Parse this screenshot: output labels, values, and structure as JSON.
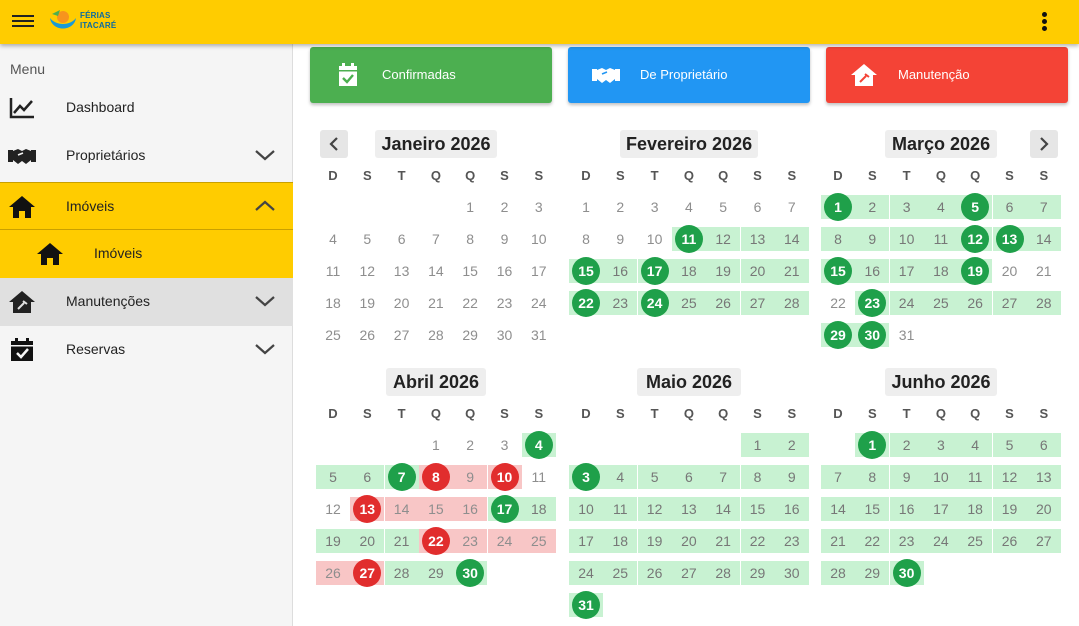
{
  "header": {
    "logo_text_line1": "FÉRIAS",
    "logo_text_line2": "ITACARÉ"
  },
  "sidebar": {
    "menu_label": "Menu",
    "items": [
      {
        "label": "Dashboard",
        "icon": "chart-line-icon"
      },
      {
        "label": "Proprietários",
        "icon": "handshake-icon"
      },
      {
        "label": "Imóveis",
        "icon": "home-icon"
      },
      {
        "label": "Imóveis",
        "icon": "home-icon"
      },
      {
        "label": "Manutenções",
        "icon": "home-repair-icon"
      },
      {
        "label": "Reservas",
        "icon": "calendar-check-icon"
      }
    ]
  },
  "legend": {
    "confirmed": {
      "label": "Confirmadas",
      "color": "#4caf50",
      "icon": "calendar-check-icon"
    },
    "owner": {
      "label": "De Proprietário",
      "color": "#2196f3",
      "icon": "handshake-icon"
    },
    "maintenance": {
      "label": "Manutenção",
      "color": "#f44336",
      "icon": "home-repair-icon"
    }
  },
  "colors": {
    "brand": "#ffcc00",
    "confirmed_range": "#c8f2d2",
    "confirmed_marker": "#1fa04a",
    "maintenance_range": "#f8c6c6",
    "maintenance_marker": "#e12d2d"
  },
  "weekdays": [
    "D",
    "S",
    "T",
    "Q",
    "Q",
    "S",
    "S"
  ],
  "months": [
    {
      "title": "Janeiro 2026",
      "first_weekday": 4,
      "days": 31,
      "green": [],
      "red": [],
      "green_dots": [],
      "red_dots": []
    },
    {
      "title": "Fevereiro 2026",
      "first_weekday": 0,
      "days": 28,
      "green": [
        11,
        12,
        13,
        14,
        15,
        16,
        17,
        18,
        19,
        20,
        21,
        22,
        23,
        24,
        25,
        26,
        27,
        28
      ],
      "red": [],
      "green_dots": [
        11,
        15,
        17,
        22,
        24
      ],
      "red_dots": []
    },
    {
      "title": "Março 2026",
      "first_weekday": 0,
      "days": 31,
      "green": [
        1,
        2,
        3,
        4,
        5,
        6,
        7,
        8,
        9,
        10,
        11,
        12,
        13,
        14,
        15,
        16,
        17,
        18,
        19,
        23,
        24,
        25,
        26,
        27,
        28,
        29,
        30
      ],
      "red": [],
      "green_dots": [
        1,
        5,
        12,
        13,
        15,
        19,
        23,
        29,
        30
      ],
      "red_dots": []
    },
    {
      "title": "Abril 2026",
      "first_weekday": 3,
      "days": 30,
      "green": [
        4,
        5,
        6,
        7,
        17,
        18,
        19,
        20,
        21,
        28,
        29,
        30
      ],
      "red": [
        8,
        9,
        10,
        13,
        14,
        15,
        16,
        22,
        23,
        24,
        25,
        26,
        27
      ],
      "green_dots": [
        4,
        7,
        17,
        30
      ],
      "red_dots": [
        8,
        10,
        13,
        22,
        27
      ]
    },
    {
      "title": "Maio 2026",
      "first_weekday": 5,
      "days": 31,
      "green": [
        1,
        2,
        3,
        4,
        5,
        6,
        7,
        8,
        9,
        10,
        11,
        12,
        13,
        14,
        15,
        16,
        17,
        18,
        19,
        20,
        21,
        22,
        23,
        24,
        25,
        26,
        27,
        28,
        29,
        30,
        31
      ],
      "red": [],
      "green_dots": [
        3,
        31
      ],
      "red_dots": []
    },
    {
      "title": "Junho 2026",
      "first_weekday": 1,
      "days": 30,
      "green": [
        1,
        2,
        3,
        4,
        5,
        6,
        7,
        8,
        9,
        10,
        11,
        12,
        13,
        14,
        15,
        16,
        17,
        18,
        19,
        20,
        21,
        22,
        23,
        24,
        25,
        26,
        27,
        28,
        29,
        30
      ],
      "red": [],
      "green_dots": [
        1,
        30
      ],
      "red_dots": []
    }
  ]
}
